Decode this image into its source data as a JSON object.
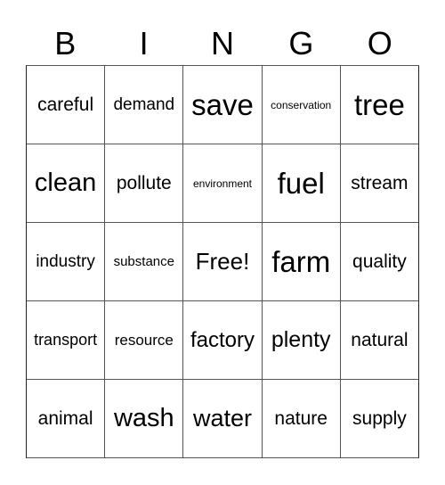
{
  "header": {
    "letters": [
      "B",
      "I",
      "N",
      "G",
      "O"
    ]
  },
  "cells": [
    [
      "careful",
      "demand",
      "save",
      "conservation",
      "tree"
    ],
    [
      "clean",
      "pollute",
      "environment",
      "fuel",
      "stream"
    ],
    [
      "industry",
      "substance",
      "Free!",
      "farm",
      "quality"
    ],
    [
      "transport",
      "resource",
      "factory",
      "plenty",
      "natural"
    ],
    [
      "animal",
      "wash",
      "water",
      "nature",
      "supply"
    ]
  ]
}
